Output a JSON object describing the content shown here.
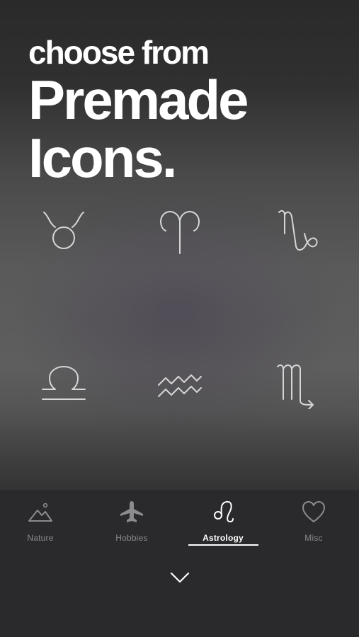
{
  "headline": {
    "line1": "choose from",
    "line2": "Premade",
    "line3": "Icons."
  },
  "icons": [
    "taurus-icon",
    "aries-icon",
    "capricorn-icon",
    "libra-icon",
    "aquarius-icon",
    "scorpio-icon"
  ],
  "tabs": [
    {
      "label": "Nature",
      "icon": "mountain-icon",
      "active": false
    },
    {
      "label": "Hobbies",
      "icon": "airplane-icon",
      "active": false
    },
    {
      "label": "Astrology",
      "icon": "leo-icon",
      "active": true
    },
    {
      "label": "Misc",
      "icon": "heart-icon",
      "active": false
    }
  ],
  "colors": {
    "tab_inactive": "#8b8a8d",
    "tab_active": "#ffffff",
    "icon_stroke": "#d6d6d6",
    "tabbar_bg": "#2a292b"
  }
}
